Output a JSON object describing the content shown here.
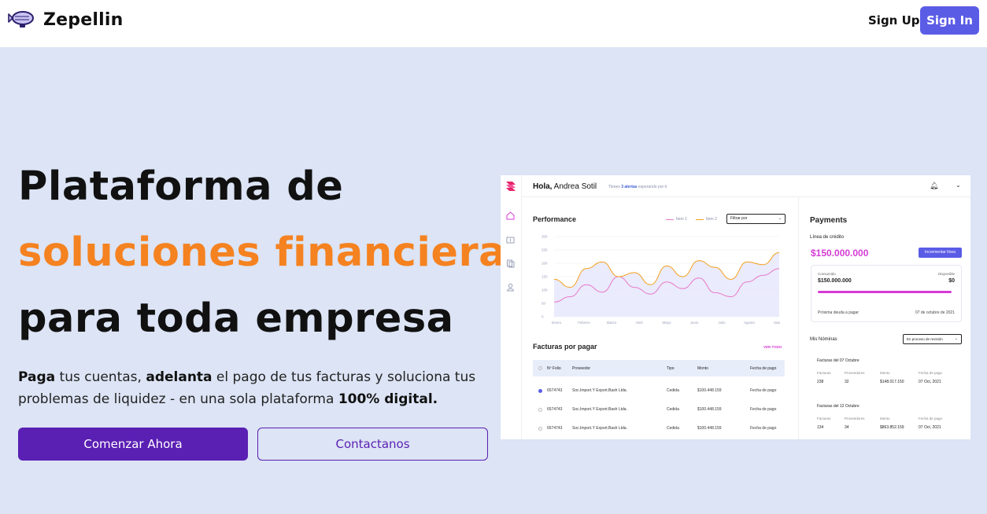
{
  "nav": {
    "brand": "Zepellin",
    "signup_label": "Sign Up",
    "signin_label": "Sign In",
    "accent_color": "#5b5ce6"
  },
  "hero": {
    "line1": "Plataforma de",
    "line2": "soluciones financieras",
    "line3": "para toda empresa",
    "accent_color": "#f58220",
    "sub_bold1": "Paga",
    "sub_text1": " tus cuentas, ",
    "sub_bold2": "adelanta",
    "sub_text2": " el pago de tus facturas y soluciona tus problemas de liquidez - en una sola plataforma ",
    "sub_bold3": "100% digital.",
    "primary_label": "Comenzar Ahora",
    "secondary_label": "Contactanos",
    "button_color": "#5a1fb3"
  },
  "dashboard": {
    "greeting_bold": "Hola,",
    "greeting_name": " Andrea Sotil",
    "alert_prefix": "Tienes ",
    "alert_link": "3 alertas",
    "alert_suffix": " esperando por ti",
    "performance": {
      "title": "Performance",
      "legend": [
        {
          "name": "Item 1",
          "color": "#e879c9"
        },
        {
          "name": "Item 2",
          "color": "#f59e1b"
        }
      ],
      "filter_label": "Filtrar por"
    },
    "chart_data": {
      "type": "area",
      "categories": [
        "Enero",
        "Febrero",
        "Marzo",
        "Abril",
        "Mayo",
        "Junio",
        "Julio",
        "Agosto",
        "Sep"
      ],
      "yticks": [
        0,
        50,
        100,
        150,
        200,
        250,
        300
      ],
      "ylim": [
        0,
        300
      ],
      "series": [
        {
          "name": "Item 1",
          "color": "#e879c9",
          "values": [
            55,
            75,
            120,
            92,
            150,
            110,
            85,
            130,
            105,
            145,
            90,
            75,
            130,
            155,
            180
          ]
        },
        {
          "name": "Item 2",
          "color": "#f59e1b",
          "values": [
            140,
            110,
            180,
            205,
            150,
            165,
            120,
            190,
            150,
            210,
            185,
            140,
            205,
            195,
            240
          ]
        }
      ]
    },
    "facturas": {
      "title": "Facturas por pagar",
      "view_all": "VER TODO",
      "columns": [
        "Nº Folio",
        "Proveedor",
        "Tipo",
        "Monto",
        "Fecha de pago"
      ],
      "rows": [
        {
          "folio": "6574743",
          "proveedor": "Soc.Import.Y Export.Bash Ltda.",
          "tipo": "Cedida",
          "monto": "$100.448.159",
          "fecha": "Fecha de pago"
        },
        {
          "folio": "6574743",
          "proveedor": "Soc.Import.Y Export.Bash Ltda.",
          "tipo": "Cedida",
          "monto": "$100.448.159",
          "fecha": "Fecha de pago"
        },
        {
          "folio": "6574743",
          "proveedor": "Soc.Import.Y Export.Bash Ltda.",
          "tipo": "Cedida",
          "monto": "$100.448.159",
          "fecha": "Fecha de pago"
        }
      ]
    },
    "payments": {
      "title": "Payments",
      "credit_line_label": "Línea de crédito",
      "amount": "$150.000.000",
      "increment_label": "Incrementar línea",
      "consumed_label": "Consumido",
      "consumed_value": "$150.000.000",
      "available_label": "Disponible",
      "available_value": "$0",
      "next_debt_label": "Próxima deuda a pagar",
      "next_debt_date": "07 de octubre de 2021",
      "progress": 1.0
    },
    "nominas": {
      "title": "Mis Nóminas",
      "filter_label": "En proceso de revisión",
      "labels": [
        "Facturas",
        "Proveedores",
        "Monto",
        "Fecha de pago"
      ],
      "cards": [
        {
          "title": "Facturas del 07 Octubre",
          "values": [
            "238",
            "32",
            "$148.017.150",
            "07 Oct, 2021"
          ]
        },
        {
          "title": "Facturas del 12 Octubre",
          "values": [
            "134",
            "34",
            "$863.852.159",
            "07 Oct, 2021"
          ]
        }
      ]
    }
  }
}
